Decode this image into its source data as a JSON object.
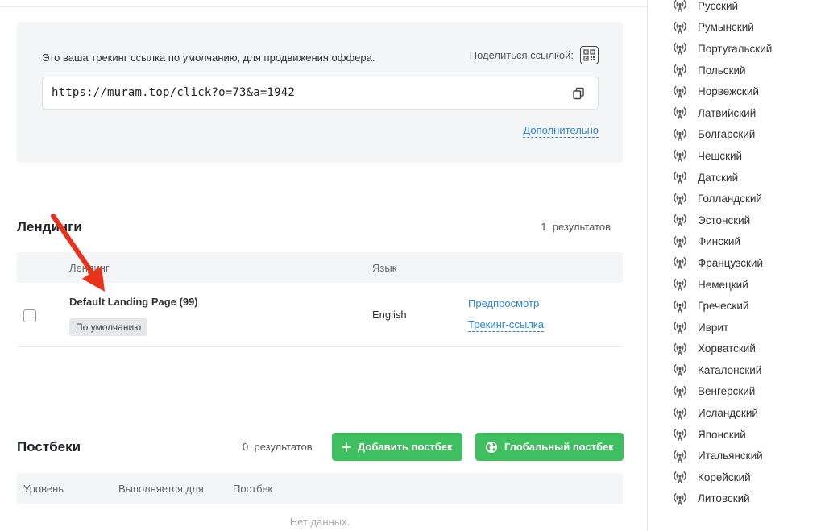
{
  "tracking": {
    "description": "Это ваша трекинг ссылка по умолчанию, для продвижения оффера.",
    "share_label": "Поделиться ссылкой:",
    "link": "https://muram.top/click?o=73&a=1942",
    "more": "Дополнительно"
  },
  "landings": {
    "title": "Лендинги",
    "results_count": "1",
    "results_label": "результатов",
    "columns": [
      "Лендинг",
      "Язык"
    ],
    "rows": [
      {
        "name": "Default Landing Page (99)",
        "badge": "По умолчанию",
        "language": "English",
        "preview": "Предпросмотр",
        "tracking_link": "Трекинг-ссылка"
      }
    ]
  },
  "postbacks": {
    "title": "Постбеки",
    "results_count": "0",
    "results_label": "результатов",
    "add_button": "Добавить постбек",
    "global_button": "Глобальный постбек",
    "columns": [
      "Уровень",
      "Выполняется для",
      "Постбек"
    ],
    "empty": "Нет данных."
  },
  "languages": [
    "Русский",
    "Румынский",
    "Португальский",
    "Польский",
    "Норвежский",
    "Латвийский",
    "Болгарский",
    "Чешский",
    "Датский",
    "Голландский",
    "Эстонский",
    "Финский",
    "Французский",
    "Немецкий",
    "Греческий",
    "Иврит",
    "Хорватский",
    "Каталонский",
    "Венгерский",
    "Исландский",
    "Японский",
    "Итальянский",
    "Корейский",
    "Литовский"
  ],
  "icons": {
    "language_item": "broadcast-icon",
    "copy": "copy-icon",
    "qr": "qr-code-icon",
    "add": "plus-icon",
    "global": "globe-icon",
    "annotation": "red-arrow"
  },
  "colors": {
    "accent_link": "#2f86d6",
    "button_green": "#3fbf5f",
    "arrow_red": "#e8321c"
  }
}
